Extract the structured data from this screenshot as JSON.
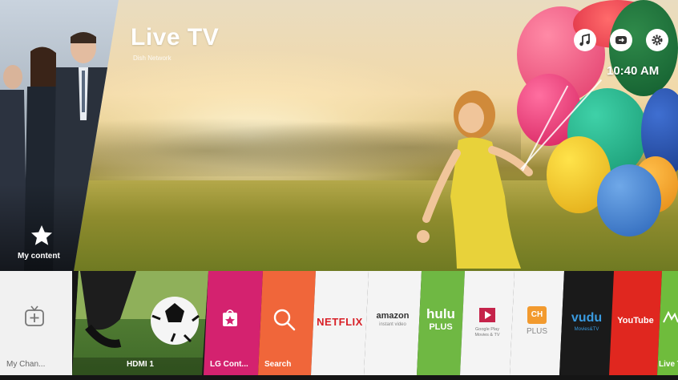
{
  "hero": {
    "title": "Live TV",
    "subtitle": "Dish Network",
    "clock": "10:40 AM"
  },
  "top_icons": [
    "music-icon",
    "input-icon",
    "settings-icon"
  ],
  "poster": {
    "label": "My content",
    "icon": "star-icon"
  },
  "launcher": [
    {
      "id": "my-channels",
      "label": "My Chan...",
      "color": "#f1f1f1"
    },
    {
      "id": "hdmi1",
      "label": "HDMI 1",
      "color": "#5b7a3a"
    },
    {
      "id": "lg-content",
      "label": "LG Cont...",
      "color": "#d4226f"
    },
    {
      "id": "search",
      "label": "Search",
      "color": "#f0663a"
    },
    {
      "id": "netflix",
      "label": "",
      "logo": "NETFLIX",
      "color": "#f4f4f4"
    },
    {
      "id": "amazon",
      "label": "",
      "logo": "amazon",
      "sub": "instant video",
      "color": "#f4f4f4"
    },
    {
      "id": "hulu",
      "label": "",
      "logo": "hulu",
      "sub": "PLUS",
      "color": "#6fb843"
    },
    {
      "id": "google-play",
      "label": "",
      "logo": "Google Play",
      "sub": "Movies & TV",
      "color": "#f4f4f4"
    },
    {
      "id": "ch-plus",
      "label": "",
      "logo": "CH",
      "sub": "PLUS",
      "color": "#f4f4f4"
    },
    {
      "id": "vudu",
      "label": "",
      "logo": "vudu",
      "sub": "Movies&TV",
      "color": "#1a1a1a"
    },
    {
      "id": "youtube",
      "label": "",
      "logo": "YouTube",
      "color": "#e0271f"
    },
    {
      "id": "live-tv",
      "label": "Live T",
      "color": "#6fbc3c"
    }
  ]
}
